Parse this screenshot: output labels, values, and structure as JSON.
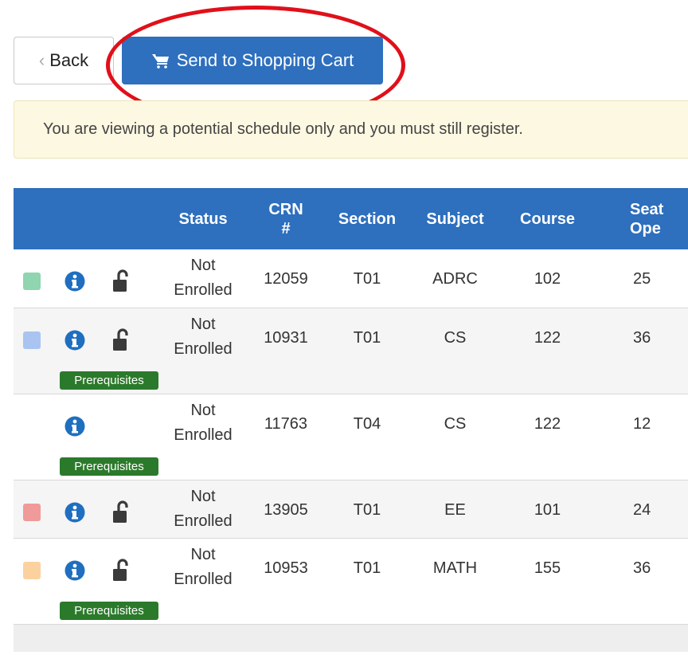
{
  "toolbar": {
    "back_label": "Back",
    "cart_label": "Send to Shopping Cart"
  },
  "notice": {
    "text": "You are viewing a potential schedule only and you must still register."
  },
  "table": {
    "headers": {
      "status": "Status",
      "crn_line1": "CRN",
      "crn_line2": "#",
      "section": "Section",
      "subject": "Subject",
      "course": "Course",
      "seats_line1": "Seat",
      "seats_line2": "Ope"
    },
    "prereq_label": "Prerequisites",
    "rows": [
      {
        "color": "#8fd5b0",
        "status_line1": "Not",
        "status_line2": "Enrolled",
        "crn": "12059",
        "section": "T01",
        "subject": "ADRC",
        "course": "102",
        "seats": "25",
        "has_lock": true,
        "has_prereq": false
      },
      {
        "color": "#a9c4f0",
        "status_line1": "Not",
        "status_line2": "Enrolled",
        "crn": "10931",
        "section": "T01",
        "subject": "CS",
        "course": "122",
        "seats": "36",
        "has_lock": true,
        "has_prereq": true
      },
      {
        "color": "",
        "status_line1": "Not",
        "status_line2": "Enrolled",
        "crn": "11763",
        "section": "T04",
        "subject": "CS",
        "course": "122",
        "seats": "12",
        "has_lock": false,
        "has_prereq": true
      },
      {
        "color": "#f09a9a",
        "status_line1": "Not",
        "status_line2": "Enrolled",
        "crn": "13905",
        "section": "T01",
        "subject": "EE",
        "course": "101",
        "seats": "24",
        "has_lock": true,
        "has_prereq": false
      },
      {
        "color": "#fbd29f",
        "status_line1": "Not",
        "status_line2": "Enrolled",
        "crn": "10953",
        "section": "T01",
        "subject": "MATH",
        "course": "155",
        "seats": "36",
        "has_lock": true,
        "has_prereq": true
      }
    ]
  }
}
